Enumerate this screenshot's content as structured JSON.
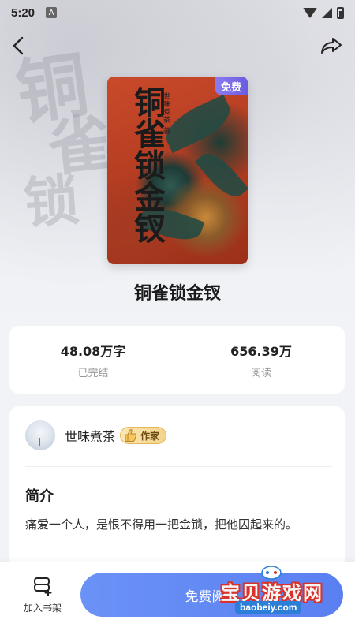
{
  "status_bar": {
    "time": "5:20",
    "notification": "A"
  },
  "book": {
    "title": "铜雀锁金钗",
    "cover_title": "铜雀锁金钗",
    "cover_author": "世味煮茶 著",
    "free_badge": "免费"
  },
  "stats": {
    "word_count": "48.08万字",
    "status": "已完结",
    "reads": "656.39万",
    "reads_label": "阅读"
  },
  "author": {
    "name": "世味煮茶",
    "badge": "作家"
  },
  "intro": {
    "heading": "简介",
    "text": "痛爱一个人，是恨不得用一把金锁，把他囚起来的。"
  },
  "bottom_bar": {
    "add_shelf_label": "加入书架",
    "read_button_label": "免费阅读"
  },
  "watermark": {
    "main": "宝贝游戏网",
    "url": "baobeiy.com"
  },
  "colors": {
    "accent": "#5a7ff2",
    "free_badge": "#7b6be8",
    "author_badge": "#f4d389"
  }
}
